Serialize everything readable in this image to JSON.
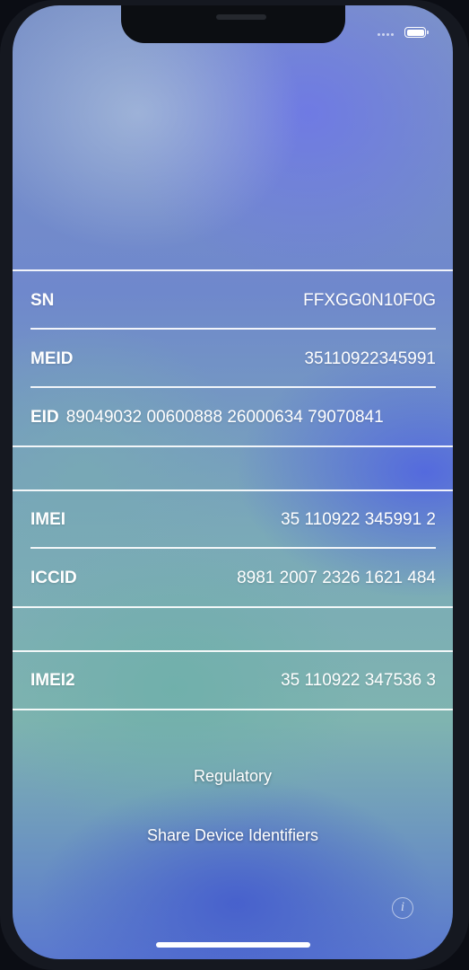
{
  "identifiers": [
    {
      "label": "SN",
      "value": "FFXGG0N10F0G"
    },
    {
      "label": "MEID",
      "value": "35110922345991"
    },
    {
      "label": "EID",
      "value": "89049032 00600888 26000634 79070841"
    },
    {
      "label": "IMEI",
      "value": "35 110922 345991 2"
    },
    {
      "label": "ICCID",
      "value": "8981 2007 2326 1621 484"
    },
    {
      "label": "IMEI2",
      "value": "35 110922 347536 3"
    }
  ],
  "actions": {
    "regulatory": "Regulatory",
    "share": "Share Device Identifiers"
  },
  "icons": {
    "info": "i"
  }
}
